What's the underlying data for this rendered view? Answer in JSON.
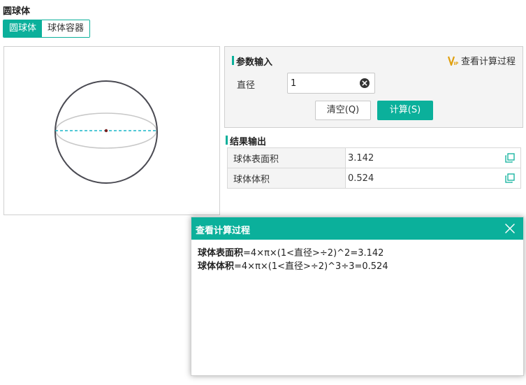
{
  "page_title": "圆球体",
  "tabs": [
    {
      "label": "圆球体",
      "active": true
    },
    {
      "label": "球体容器",
      "active": false
    }
  ],
  "params": {
    "section_title": "参数输入",
    "vip_link_label": "查看计算过程",
    "fields": [
      {
        "label": "直径",
        "value": "1"
      }
    ],
    "clear_button": "清空(Q)",
    "calc_button": "计算(S)"
  },
  "results": {
    "section_title": "结果输出",
    "rows": [
      {
        "label": "球体表面积",
        "value": "3.142"
      },
      {
        "label": "球体体积",
        "value": "0.524"
      }
    ]
  },
  "dialog": {
    "title": "查看计算过程",
    "lines": [
      {
        "name": "球体表面积",
        "formula": "=4×π×(1<直径>÷2)^2=3.142"
      },
      {
        "name": "球体体积",
        "formula": "=4×π×(1<直径>÷2)^3÷3=0.524"
      }
    ]
  },
  "colors": {
    "accent": "#0bb09b",
    "vip_gold": "#e0a010",
    "diameter_line": "#19b5c8",
    "sphere_outline": "#4a4a52",
    "equator": "#c8c8c8"
  }
}
